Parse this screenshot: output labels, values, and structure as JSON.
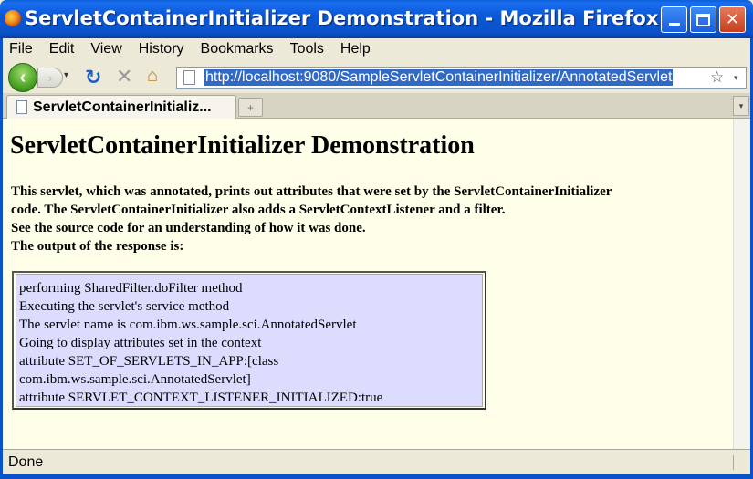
{
  "window": {
    "title": "ServletContainerInitializer Demonstration - Mozilla Firefox",
    "app_icon": "firefox-icon",
    "controls": {
      "minimize": "minimize-icon",
      "maximize": "maximize-icon",
      "close": "✕"
    }
  },
  "menubar": {
    "items": [
      "File",
      "Edit",
      "View",
      "History",
      "Bookmarks",
      "Tools",
      "Help"
    ]
  },
  "navbar": {
    "back_icon": "‹",
    "forward_icon": "›",
    "history_dropdown": "▾",
    "reload_icon": "↻",
    "stop_icon": "✕",
    "home_icon": "⌂",
    "url": "http://localhost:9080/SampleServletContainerInitializer/AnnotatedServlet",
    "bookmark_star": "☆",
    "url_dropdown": "▾"
  },
  "tabs": [
    {
      "label": "ServletContainerInitializ...",
      "active": true
    }
  ],
  "tabbar": {
    "new_tab": "+",
    "list_all": "▾"
  },
  "page": {
    "heading": "ServletContainerInitializer Demonstration",
    "description_lines": [
      "This servlet, which was annotated, prints out attributes that were set by the ServletContainerInitializer code. The ServletContainerInitializer also adds a ServletContextListener and a filter.",
      "See the source code for an understanding of how it was done.",
      "The output of the response is:"
    ],
    "output_lines": [
      "performing SharedFilter.doFilter method",
      "Executing the servlet's service method",
      "The servlet name is com.ibm.ws.sample.sci.AnnotatedServlet",
      "Going to display attributes set in the context",
      "attribute SET_OF_SERVLETS_IN_APP:[class com.ibm.ws.sample.sci.AnnotatedServlet]",
      "attribute SERVLET_CONTEXT_LISTENER_INITIALIZED:true"
    ]
  },
  "statusbar": {
    "text": "Done"
  },
  "colors": {
    "titlebar": "#0a52c9",
    "content_background": "#ffffe9",
    "output_background": "#dcdcff",
    "url_selection": "#316ac5"
  }
}
